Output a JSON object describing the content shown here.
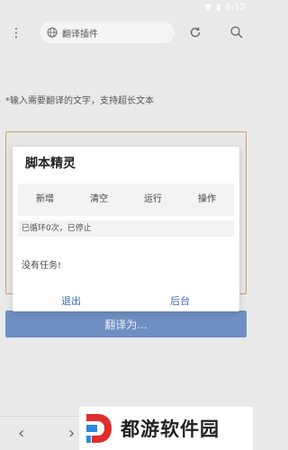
{
  "status_bar": {
    "time": "6:12"
  },
  "toolbar": {
    "menu_icon": "more-vert-icon",
    "url_text": "翻译插件",
    "refresh_icon": "refresh-icon",
    "search_icon": "search-icon"
  },
  "main": {
    "prompt": "*输入需要翻译的文字，支持超长文本",
    "translate_button": "翻译为..."
  },
  "dialog": {
    "title": "脚本精灵",
    "actions": [
      "新增",
      "清空",
      "运行",
      "操作"
    ],
    "status": "已循环0次，已停止",
    "empty_text": "没有任务!",
    "exit_label": "退出",
    "background_label": "后台"
  },
  "watermark": {
    "text": "都游软件园"
  },
  "colors": {
    "accent": "#3a68b0",
    "button": "#6f8fc2",
    "textbox_border": "#c9a35a"
  }
}
